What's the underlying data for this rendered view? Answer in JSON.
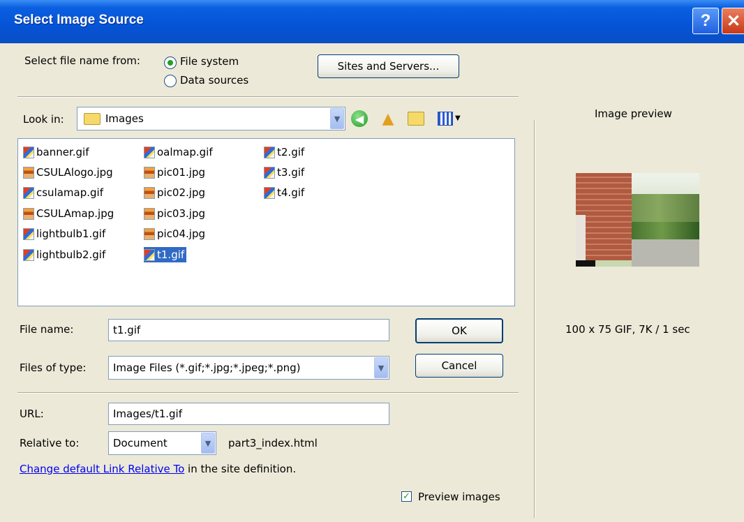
{
  "window": {
    "title": "Select Image Source",
    "help_button": "?",
    "close_button": "✕"
  },
  "source": {
    "label": "Select file name from:",
    "options": [
      {
        "label": "File system",
        "selected": true
      },
      {
        "label": "Data sources",
        "selected": false
      }
    ],
    "sites_button": "Sites and Servers..."
  },
  "lookin": {
    "label": "Look in:",
    "value": "Images"
  },
  "toolbar_icons": [
    "back-icon",
    "up-folder-icon",
    "new-folder-icon",
    "views-menu-icon"
  ],
  "files": [
    {
      "name": "banner.gif",
      "type": "gif"
    },
    {
      "name": "CSULAlogo.jpg",
      "type": "jpg"
    },
    {
      "name": "csulamap.gif",
      "type": "gif"
    },
    {
      "name": "CSULAmap.jpg",
      "type": "jpg"
    },
    {
      "name": "lightbulb1.gif",
      "type": "gif"
    },
    {
      "name": "lightbulb2.gif",
      "type": "gif"
    },
    {
      "name": "oalmap.gif",
      "type": "gif"
    },
    {
      "name": "pic01.jpg",
      "type": "jpg"
    },
    {
      "name": "pic02.jpg",
      "type": "jpg"
    },
    {
      "name": "pic03.jpg",
      "type": "jpg"
    },
    {
      "name": "pic04.jpg",
      "type": "jpg"
    },
    {
      "name": "t1.gif",
      "type": "gif",
      "selected": true
    },
    {
      "name": "t2.gif",
      "type": "gif"
    },
    {
      "name": "t3.gif",
      "type": "gif"
    },
    {
      "name": "t4.gif",
      "type": "gif"
    }
  ],
  "filename": {
    "label": "File name:",
    "value": "t1.gif"
  },
  "filetype": {
    "label": "Files of type:",
    "value": "Image Files (*.gif;*.jpg;*.jpeg;*.png)"
  },
  "buttons": {
    "ok": "OK",
    "cancel": "Cancel"
  },
  "url": {
    "label": "URL:",
    "value": "Images/t1.gif"
  },
  "relative": {
    "label": "Relative to:",
    "value": "Document",
    "file": "part3_index.html"
  },
  "change_link": {
    "link_text": "Change default Link Relative To",
    "suffix": " in the site definition."
  },
  "preview": {
    "title": "Image preview",
    "info": "100 x 75 GIF, 7K / 1 sec",
    "checkbox_label": "Preview images",
    "checked": true
  }
}
